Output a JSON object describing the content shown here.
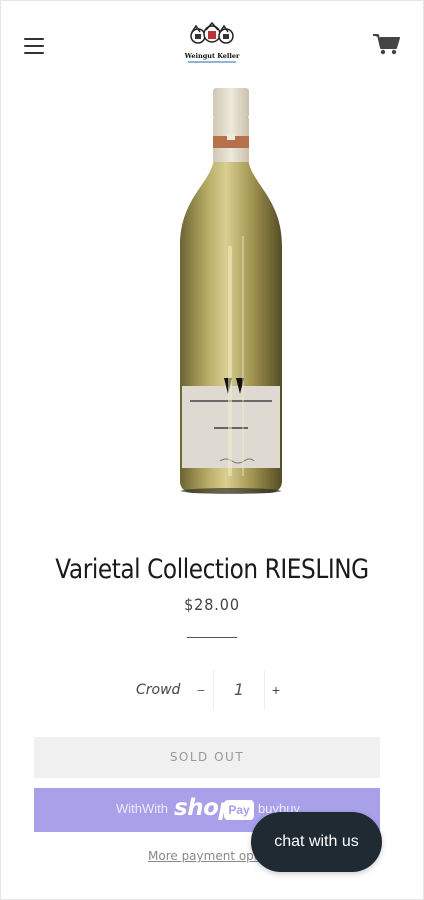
{
  "header": {
    "logo_text": "Weingut Keller",
    "menu_icon": "hamburger-icon",
    "cart_icon": "cart-icon"
  },
  "product": {
    "title": "Varietal Collection RIESLING",
    "price": "$28.00",
    "label_brand": "WEINGUT KELLER",
    "label_varietal": "RIESLING"
  },
  "quantity": {
    "label": "Crowd",
    "value": "1",
    "minus": "−",
    "plus": "+"
  },
  "buttons": {
    "sold_out": "SOLD OUT",
    "shoppay_with": "WithWith",
    "shoppay_shop": "shop",
    "shoppay_pay": "Pay",
    "shoppay_buy": "buybuy",
    "more_options": "More payment options"
  },
  "chat": {
    "label": "chat with us"
  },
  "colors": {
    "shoppay": "#a9a0ea",
    "chat_bg": "#1f2a33",
    "soldout_bg": "#f0f0f0"
  }
}
